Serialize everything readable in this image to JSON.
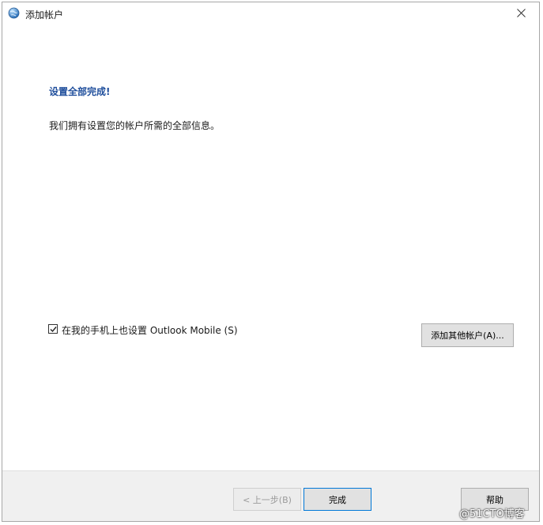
{
  "window": {
    "title": "添加帐户",
    "app_icon": "globe-icon",
    "close_icon": "close-icon"
  },
  "content": {
    "heading": "设置全部完成!",
    "description": "我们拥有设置您的帐户所需的全部信息。",
    "checkbox": {
      "label": "在我的手机上也设置 Outlook Mobile (S)",
      "checked": true
    },
    "add_other_account_label": "添加其他帐户(A)..."
  },
  "footer": {
    "back_label": "< 上一步(B)",
    "finish_label": "完成",
    "help_label": "帮助"
  },
  "watermark": "@51CTO博客",
  "colors": {
    "heading": "#1f4e9c",
    "footer_bg": "#f0f0f0",
    "button_bg": "#e1e1e1",
    "focus_border": "#0078d7"
  }
}
